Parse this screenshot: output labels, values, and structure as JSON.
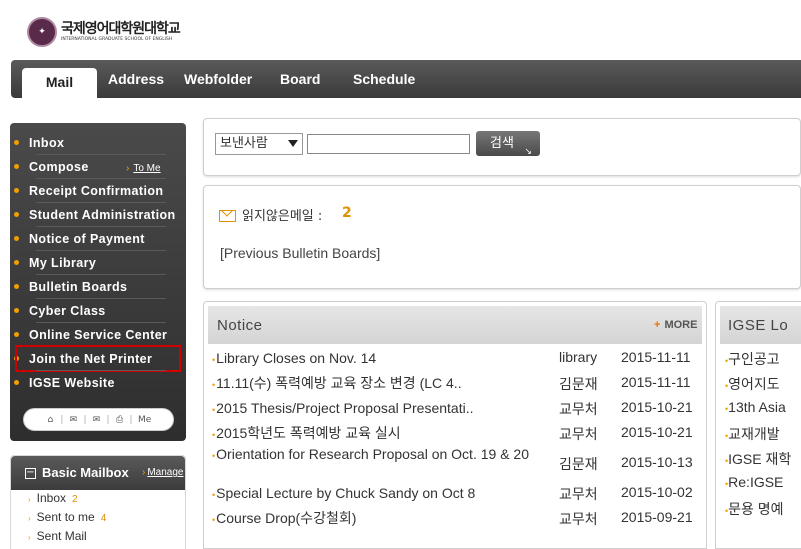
{
  "header": {
    "logo_kr": "국제영어대학원대학교",
    "logo_en": "INTERNATIONAL GRADUATE SCHOOL OF ENGLISH"
  },
  "topnav": {
    "tabs": [
      {
        "label": "Mail",
        "active": true
      },
      {
        "label": "Address"
      },
      {
        "label": "Webfolder"
      },
      {
        "label": "Board"
      },
      {
        "label": "Schedule"
      }
    ]
  },
  "sidebar": {
    "items": [
      {
        "label": "Inbox"
      },
      {
        "label": "Compose"
      },
      {
        "label": "Receipt Confirmation"
      },
      {
        "label": "Student Administration"
      },
      {
        "label": "Notice of Payment"
      },
      {
        "label": "My Library"
      },
      {
        "label": "Bulletin Boards"
      },
      {
        "label": "Cyber Class"
      },
      {
        "label": "Online Service Center"
      },
      {
        "label": "Join the Net Printer",
        "highlighted": true
      },
      {
        "label": "IGSE Website"
      }
    ],
    "to_me": "To Me",
    "tools": [
      "home-icon",
      "mail-icon",
      "mail-open-icon",
      "print-icon",
      "Me"
    ],
    "tools_me": "Me"
  },
  "mailbox": {
    "title": "Basic Mailbox",
    "manage": "Manage",
    "items": [
      {
        "label": "Inbox",
        "count": "2"
      },
      {
        "label": "Sent to me",
        "count": "4"
      },
      {
        "label": "Sent Mail",
        "count": ""
      }
    ]
  },
  "search": {
    "select_value": "보낸사람",
    "input_value": "",
    "button_label": "검색"
  },
  "unread": {
    "label": "읽지않은메일 :",
    "count": "2",
    "prev_bulletin": "[Previous Bulletin Boards]"
  },
  "notice": {
    "title": "Notice",
    "more": "MORE",
    "rows": [
      {
        "title": "Library Closes on Nov. 14",
        "author": "library",
        "date": "2015-11-11"
      },
      {
        "title": "11.11(수) 폭력예방 교육 장소 변경 (LC 4..",
        "author": "김문재",
        "date": "2015-11-11"
      },
      {
        "title": "2015 Thesis/Project Proposal Presentati..",
        "author": "교무처",
        "date": "2015-10-21"
      },
      {
        "title": "2015학년도 폭력예방 교육 실시",
        "author": "교무처",
        "date": "2015-10-21"
      },
      {
        "title": "Orientation for Research Proposal on Oct. 19 & 20",
        "author": "김문재",
        "date": "2015-10-13"
      },
      {
        "title": "Special Lecture by Chuck Sandy on Oct 8",
        "author": "교무처",
        "date": "2015-10-02"
      },
      {
        "title": "Course Drop(수강철회)",
        "author": "교무처",
        "date": "2015-09-21"
      }
    ]
  },
  "igse": {
    "title": "IGSE Lo",
    "rows": [
      "구인공고",
      "영어지도",
      "13th Asia",
      "교재개발",
      "IGSE 재학",
      "Re:IGSE",
      "문용 명예"
    ]
  },
  "colors": {
    "accent_orange": "#f0a000",
    "highlight_red": "#d00000",
    "nav_dark": "#3a3a3a"
  }
}
